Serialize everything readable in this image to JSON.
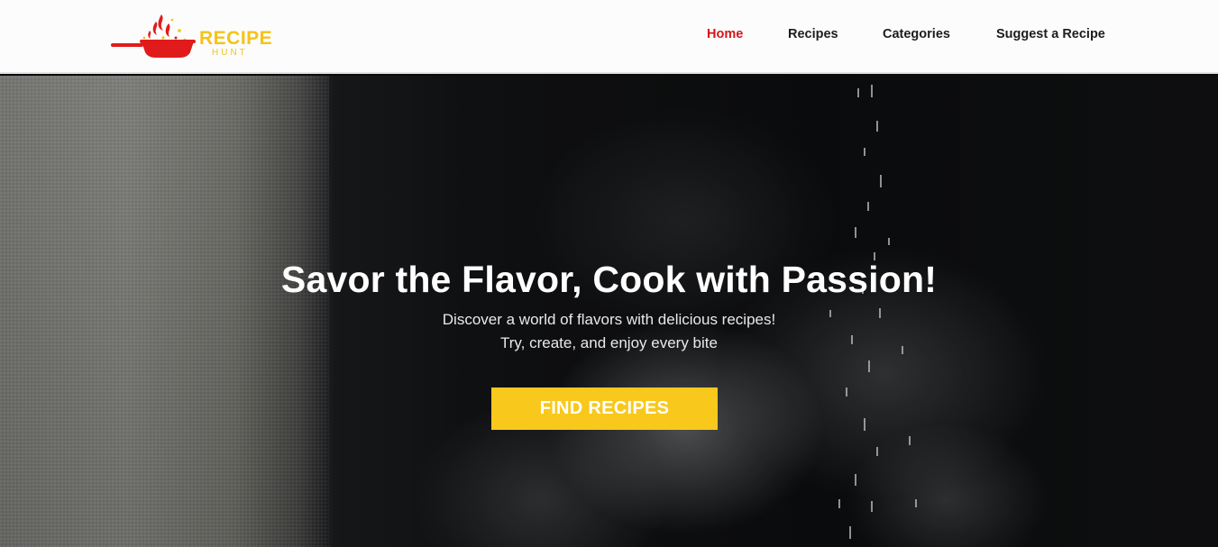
{
  "brand": {
    "logo_word": "RECIPE",
    "logo_sub": "HUNT",
    "logo_icon": "flaming-pan-icon",
    "accent_red": "#d7141a",
    "accent_yellow": "#f8c81c"
  },
  "nav": {
    "items": [
      {
        "label": "Home",
        "active": true
      },
      {
        "label": "Recipes",
        "active": false
      },
      {
        "label": "Categories",
        "active": false
      },
      {
        "label": "Suggest a Recipe",
        "active": false
      }
    ]
  },
  "hero": {
    "title": "Savor the Flavor, Cook with Passion!",
    "subtitle_line1": "Discover a world of flavors with delicious recipes!",
    "subtitle_line2": "Try, create, and enjoy every bite",
    "cta_label": "FIND RECIPES"
  }
}
